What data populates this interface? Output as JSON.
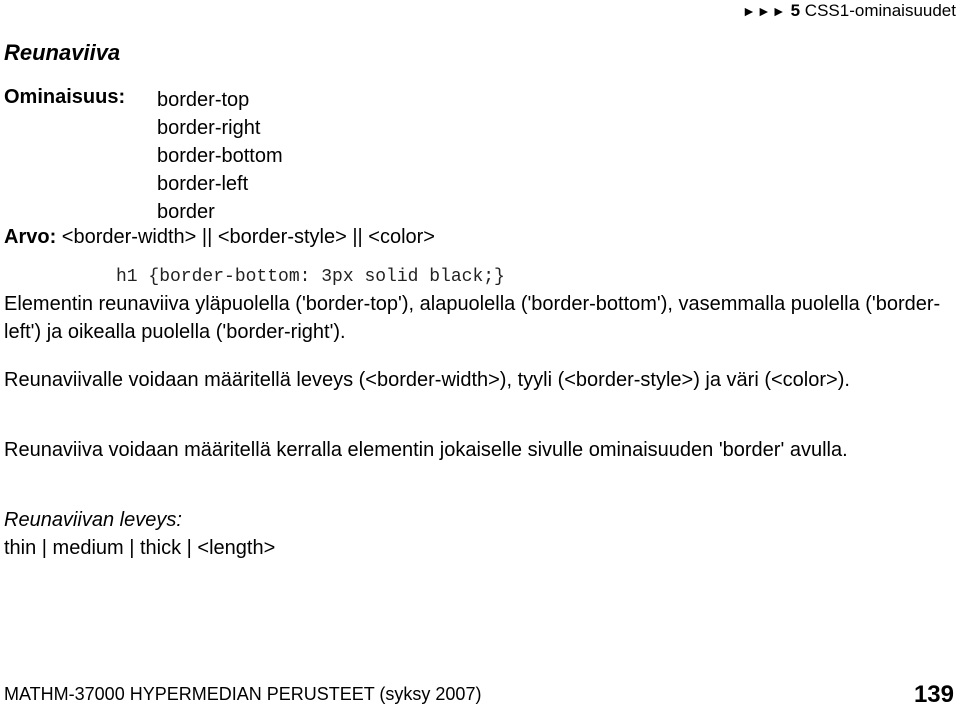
{
  "header": {
    "nav_arrows": "►►►",
    "section_number": "5",
    "section_title": "CSS1-ominaisuudet"
  },
  "title": "Reunaviiva",
  "property": {
    "label": "Ominaisuus:",
    "values": [
      "border-top",
      "border-right",
      "border-bottom",
      "border-left",
      "border"
    ]
  },
  "value": {
    "label": "Arvo:",
    "text": "<border-width> || <border-style> || <color>"
  },
  "code_example": "h1 {border-bottom: 3px solid black;}",
  "paragraphs": [
    "Elementin reunaviiva yläpuolella ('border-top'), alapuolella ('border-bottom'), vasemmalla puolella ('border-left') ja oikealla puolella ('border-right').",
    "Reunaviivalle voidaan määritellä leveys (<border-width>), tyyli (<border-style>) ja väri (<color>).",
    "Reunaviiva voidaan määritellä kerralla elementin jokaiselle sivulle ominaisuuden 'border' avulla."
  ],
  "width_section": {
    "heading": "Reunaviivan leveys:",
    "values": "thin | medium | thick | <length>"
  },
  "footer": {
    "course": "MATHM-37000 HYPERMEDIAN PERUSTEET (syksy 2007)",
    "page_number": "139"
  }
}
